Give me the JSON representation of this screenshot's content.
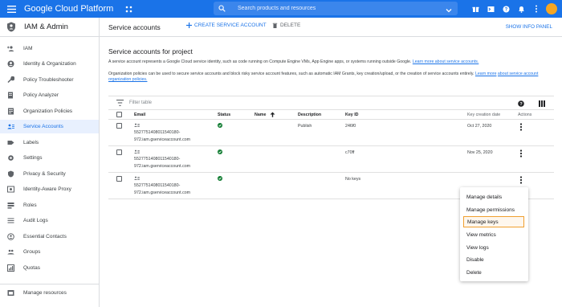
{
  "topbar": {
    "brand": "Google Cloud Platform",
    "search_placeholder": "Search products and resources"
  },
  "sidebar": {
    "title": "IAM & Admin",
    "items": [
      {
        "label": "IAM",
        "icon": "person-add-icon"
      },
      {
        "label": "Identity & Organization",
        "icon": "account-circle-icon"
      },
      {
        "label": "Policy Troubleshooter",
        "icon": "wrench-icon"
      },
      {
        "label": "Policy Analyzer",
        "icon": "document-search-icon"
      },
      {
        "label": "Organization Policies",
        "icon": "list-doc-icon"
      },
      {
        "label": "Service Accounts",
        "icon": "service-account-icon",
        "active": true
      },
      {
        "label": "Labels",
        "icon": "label-icon"
      },
      {
        "label": "Settings",
        "icon": "gear-icon"
      },
      {
        "label": "Privacy & Security",
        "icon": "shield-icon"
      },
      {
        "label": "Identity-Aware Proxy",
        "icon": "proxy-icon"
      },
      {
        "label": "Roles",
        "icon": "roles-icon"
      },
      {
        "label": "Audit Logs",
        "icon": "list-icon"
      },
      {
        "label": "Essential Contacts",
        "icon": "contacts-icon"
      },
      {
        "label": "Groups",
        "icon": "groups-icon"
      },
      {
        "label": "Quotas",
        "icon": "quota-icon"
      }
    ],
    "footer_item": {
      "label": "Manage resources",
      "icon": "folder-icon"
    }
  },
  "actionbar": {
    "title": "Service accounts",
    "create": "CREATE SERVICE ACCOUNT",
    "delete": "DELETE",
    "show_info": "SHOW INFO PANEL"
  },
  "content": {
    "title": "Service accounts for project",
    "desc1": "A service account represents a Google Cloud service identity, such as code running on Compute Engine VMs, App Engine apps, or systems running outside Google.",
    "desc1_link": "Learn more about service accounts.",
    "desc2": "Organization policies can be used to secure service accounts and block risky service account features, such as automatic IAM Grants, key creation/upload, or the creation of service accounts entirely.",
    "desc2_link_a": "Learn more",
    "desc2_link_b": "about service account organization policies."
  },
  "table": {
    "filter_placeholder": "Filter table",
    "headers": {
      "email": "Email",
      "status": "Status",
      "name": "Name",
      "description": "Description",
      "key_id": "Key ID",
      "key_date": "Key creation date",
      "actions": "Actions"
    },
    "rows": [
      {
        "email1": "5527751408011540180-",
        "email2": "972.iam.gserviceaccount.com",
        "description": "Publish",
        "key_id": "246f0",
        "key_date": "Oct 27, 2020"
      },
      {
        "email1": "5527751408011540180-",
        "email2": "972.iam.gserviceaccount.com",
        "description": "",
        "key_id": "c70ff",
        "key_date": "Nov 25, 2020"
      },
      {
        "email1": "5527751408011540180-",
        "email2": "972.iam.gserviceaccount.com",
        "description": "",
        "key_id": "No keys",
        "key_date": ""
      }
    ]
  },
  "menu": {
    "items": [
      "Manage details",
      "Manage permissions",
      "Manage keys",
      "View metrics",
      "View logs",
      "Disable",
      "Delete"
    ],
    "highlighted": "Manage keys"
  }
}
